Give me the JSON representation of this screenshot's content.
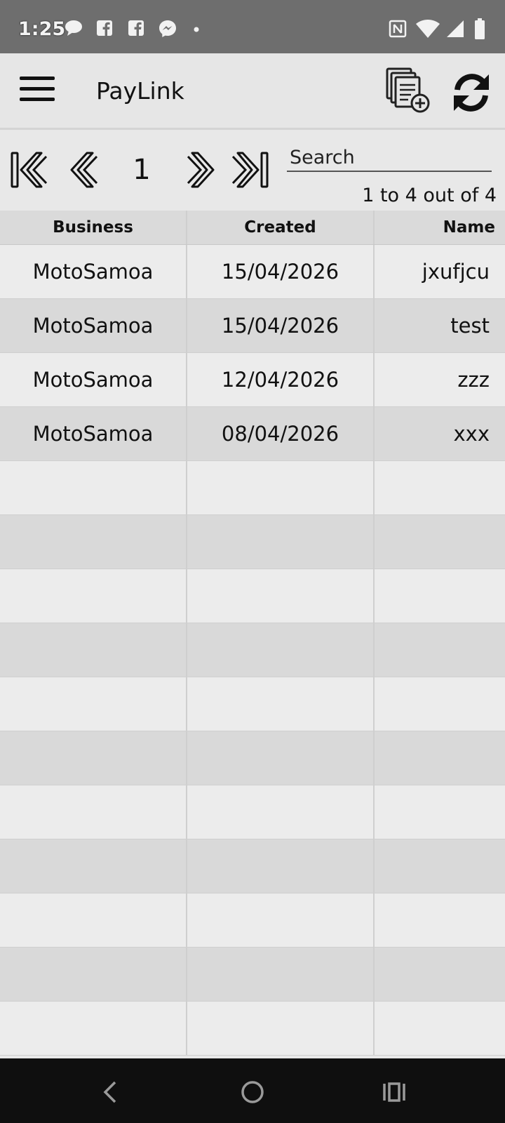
{
  "status_bar": {
    "time": "1:25",
    "icons": [
      "chat-icon",
      "facebook-icon",
      "facebook-icon",
      "messenger-icon",
      "dot-icon",
      "nfc-icon",
      "wifi-icon",
      "signal-icon",
      "battery-icon"
    ]
  },
  "app_bar": {
    "title": "PayLink",
    "icons": [
      "menu-icon",
      "new-document-icon",
      "refresh-icon"
    ]
  },
  "pager": {
    "current_page": "1",
    "search_placeholder": "Search",
    "range_text": "1 to 4 out of 4",
    "icons": [
      "first-page-icon",
      "previous-page-icon",
      "next-page-icon",
      "last-page-icon"
    ]
  },
  "table": {
    "columns": [
      "Business",
      "Created",
      "Name"
    ],
    "rows": [
      [
        "MotoSamoa",
        "15/04/2026",
        "jxufjcu"
      ],
      [
        "MotoSamoa",
        "15/04/2026",
        "test"
      ],
      [
        "MotoSamoa",
        "12/04/2026",
        "zzz"
      ],
      [
        "MotoSamoa",
        "08/04/2026",
        "xxx"
      ],
      [
        "",
        "",
        ""
      ],
      [
        "",
        "",
        ""
      ],
      [
        "",
        "",
        ""
      ],
      [
        "",
        "",
        ""
      ],
      [
        "",
        "",
        ""
      ],
      [
        "",
        "",
        ""
      ],
      [
        "",
        "",
        ""
      ],
      [
        "",
        "",
        ""
      ],
      [
        "",
        "",
        ""
      ],
      [
        "",
        "",
        ""
      ],
      [
        "",
        "",
        ""
      ]
    ]
  },
  "nav_bar": {
    "icons": [
      "back-icon",
      "home-icon",
      "recents-icon"
    ]
  }
}
